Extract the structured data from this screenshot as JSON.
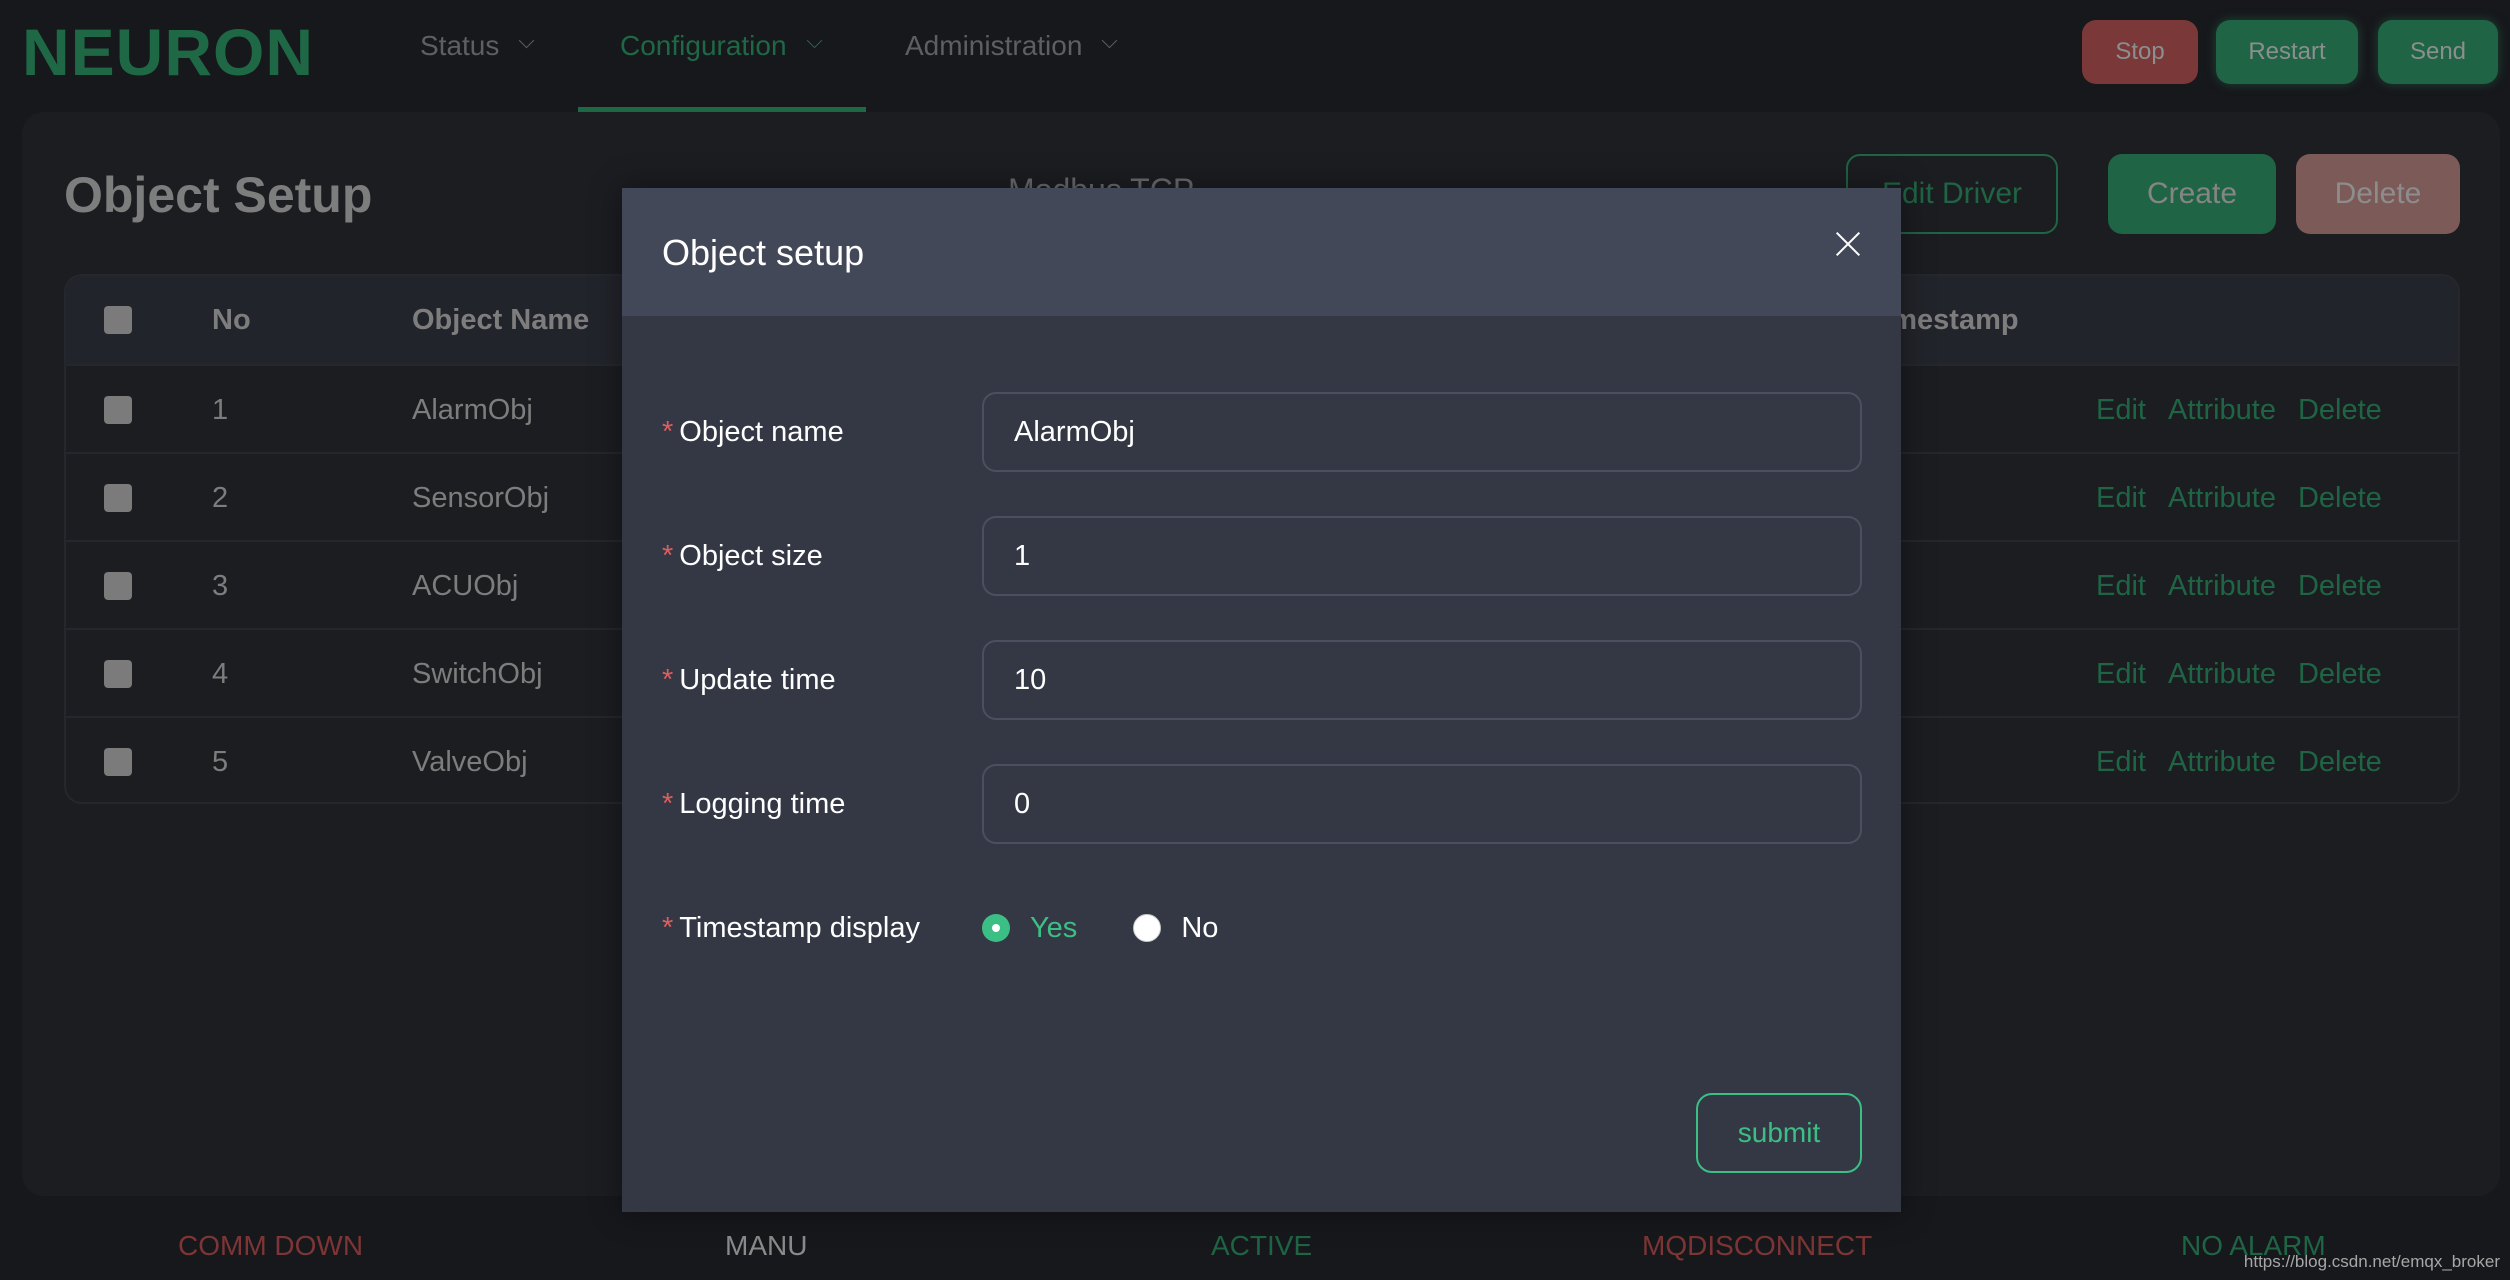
{
  "app": {
    "logo": "NEURON"
  },
  "nav": {
    "items": [
      {
        "label": "Status",
        "active": false
      },
      {
        "label": "Configuration",
        "active": true
      },
      {
        "label": "Administration",
        "active": false
      }
    ]
  },
  "top_actions": {
    "stop": "Stop",
    "restart": "Restart",
    "send": "Send"
  },
  "page": {
    "title": "Object Setup",
    "driver_name": "Modbus TCP",
    "edit_driver": "Edit Driver",
    "create": "Create",
    "delete": "Delete"
  },
  "table": {
    "headers": {
      "no": "No",
      "object_name": "Object Name",
      "timestamp": "Timestamp"
    },
    "rows": [
      {
        "no": "1",
        "name": "AlarmObj"
      },
      {
        "no": "2",
        "name": "SensorObj"
      },
      {
        "no": "3",
        "name": "ACUObj"
      },
      {
        "no": "4",
        "name": "SwitchObj"
      },
      {
        "no": "5",
        "name": "ValveObj"
      }
    ],
    "actions": {
      "edit": "Edit",
      "attribute": "Attribute",
      "delete": "Delete"
    }
  },
  "modal": {
    "title": "Object setup",
    "fields": {
      "object_name": {
        "label": "Object name",
        "value": "AlarmObj"
      },
      "object_size": {
        "label": "Object size",
        "value": "1"
      },
      "update_time": {
        "label": "Update time",
        "value": "10"
      },
      "logging_time": {
        "label": "Logging time",
        "value": "0"
      }
    },
    "timestamp_display": {
      "label": "Timestamp display",
      "options": [
        "Yes",
        "No"
      ],
      "selected": "Yes"
    },
    "required_mark": "*",
    "submit": "submit"
  },
  "statusbar": {
    "items": [
      {
        "label": "COMM DOWN",
        "color": "#7d3535"
      },
      {
        "label": "MANU",
        "color": "#8a8a8a"
      },
      {
        "label": "ACTIVE",
        "color": "#1f6444"
      },
      {
        "label": "MQDISCONNECT",
        "color": "#7d3535"
      },
      {
        "label": "NO ALARM",
        "color": "#1f6444"
      }
    ],
    "watermark": "https://blog.csdn.net/emqx_broker"
  },
  "colors": {
    "brand": "#1f6846",
    "accent": "#3cbf84",
    "danger": "#7a3838"
  }
}
